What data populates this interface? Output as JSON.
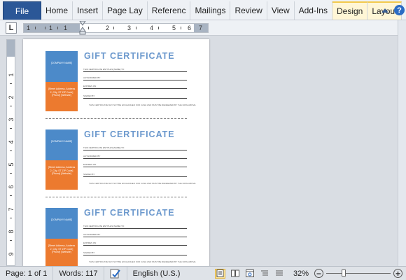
{
  "ribbon": {
    "file_label": "File",
    "tabs": [
      "Home",
      "Insert",
      "Page Lay",
      "Referenc",
      "Mailings",
      "Review",
      "View",
      "Add-Ins",
      "Design",
      "Layout"
    ]
  },
  "ruler": {
    "tab_stop_glyph": "L",
    "numbers": [
      "1",
      "1",
      "1",
      "2",
      "3",
      "4",
      "5",
      "6",
      "7"
    ],
    "vertical_numbers": [
      "1",
      "2",
      "3",
      "4",
      "5",
      "6",
      "7",
      "8",
      "9"
    ]
  },
  "document": {
    "certificates": [
      {
        "title": "GIFT CERTIFICATE",
        "company_placeholder": "[COMPANY NAME]",
        "address_placeholder": "[Street Address, Address 2, City, ST ZIP Code] [Phone] [Website]",
        "field_labels": [
          "THIS CERTIFICATE ENTITLES [NAME] TO",
          "AUTHORIZED BY",
          "EXPIRES ON",
          "SIGNED BY"
        ],
        "fine_print": "THIS CERTIFICATE MAY NOT BE EXCHANGED FOR CASH AND MUST BE REDEEMED BY THE DATE ABOVE."
      },
      {
        "title": "GIFT CERTIFICATE",
        "company_placeholder": "[COMPANY NAME]",
        "address_placeholder": "[Street Address, Address 2, City, ST ZIP Code] [Phone] [Website]",
        "field_labels": [
          "THIS CERTIFICATE ENTITLES [NAME] TO",
          "AUTHORIZED BY",
          "EXPIRES ON",
          "SIGNED BY"
        ],
        "fine_print": "THIS CERTIFICATE MAY NOT BE EXCHANGED FOR CASH AND MUST BE REDEEMED BY THE DATE ABOVE."
      },
      {
        "title": "GIFT CERTIFICATE",
        "company_placeholder": "[COMPANY NAME]",
        "address_placeholder": "[Street Address, Address 2, City, ST ZIP Code] [Phone] [Website]",
        "field_labels": [
          "THIS CERTIFICATE ENTITLES [NAME] TO",
          "AUTHORIZED BY",
          "EXPIRES ON",
          "SIGNED BY"
        ],
        "fine_print": "THIS CERTIFICATE MAY NOT BE EXCHANGED FOR CASH AND MUST BE REDEEMED BY THE DATE ABOVE."
      }
    ],
    "colors": {
      "blue": "#4c8ac9",
      "orange": "#ec7a2f",
      "title": "#6b98cd"
    }
  },
  "status": {
    "page": "Page: 1 of 1",
    "words": "Words: 117",
    "language": "English (U.S.)",
    "zoom": "32%",
    "zoom_minus": "−",
    "zoom_plus": "+"
  },
  "icons": [
    "proofing-icon",
    "print-layout-icon",
    "full-screen-reading-icon",
    "web-layout-icon",
    "outline-icon",
    "draft-icon",
    "help-icon",
    "collapse-ribbon-icon"
  ]
}
